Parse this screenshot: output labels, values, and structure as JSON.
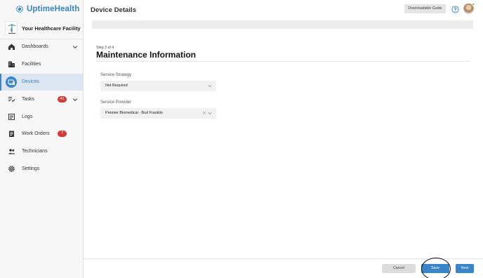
{
  "brand": {
    "name": "UptimeHealth"
  },
  "facility": {
    "name": "Your Healthcare Facility"
  },
  "sidebar": {
    "items": [
      {
        "label": "Dashboards",
        "icon": "home-icon",
        "chevron": true
      },
      {
        "label": "Facilities",
        "icon": "building-icon"
      },
      {
        "label": "Devices",
        "icon": "devices-icon",
        "active": true
      },
      {
        "label": "Tasks",
        "icon": "tasks-icon",
        "badge": "41",
        "chevron": true
      },
      {
        "label": "Logs",
        "icon": "logs-icon"
      },
      {
        "label": "Work Orders",
        "icon": "work-orders-icon",
        "badge": "7"
      },
      {
        "label": "Technicians",
        "icon": "technicians-icon"
      },
      {
        "label": "Settings",
        "icon": "gear-icon"
      }
    ]
  },
  "header": {
    "title": "Device Details",
    "guide_label": "Downloadable Guide"
  },
  "form": {
    "step": "Step 2 of 4",
    "title": "Maintenance Information",
    "fields": [
      {
        "label": "Service Strategy",
        "value": "Not Required"
      },
      {
        "label": "Service Provider",
        "value": "Premier Biomedical - Bud Franklin"
      }
    ]
  },
  "footer": {
    "cancel_label": "Cancel",
    "save_label": "Save",
    "next_label": "Next"
  },
  "colors": {
    "accent": "#3a84c9",
    "badge": "#d03b37",
    "status": "#2bb24c"
  }
}
